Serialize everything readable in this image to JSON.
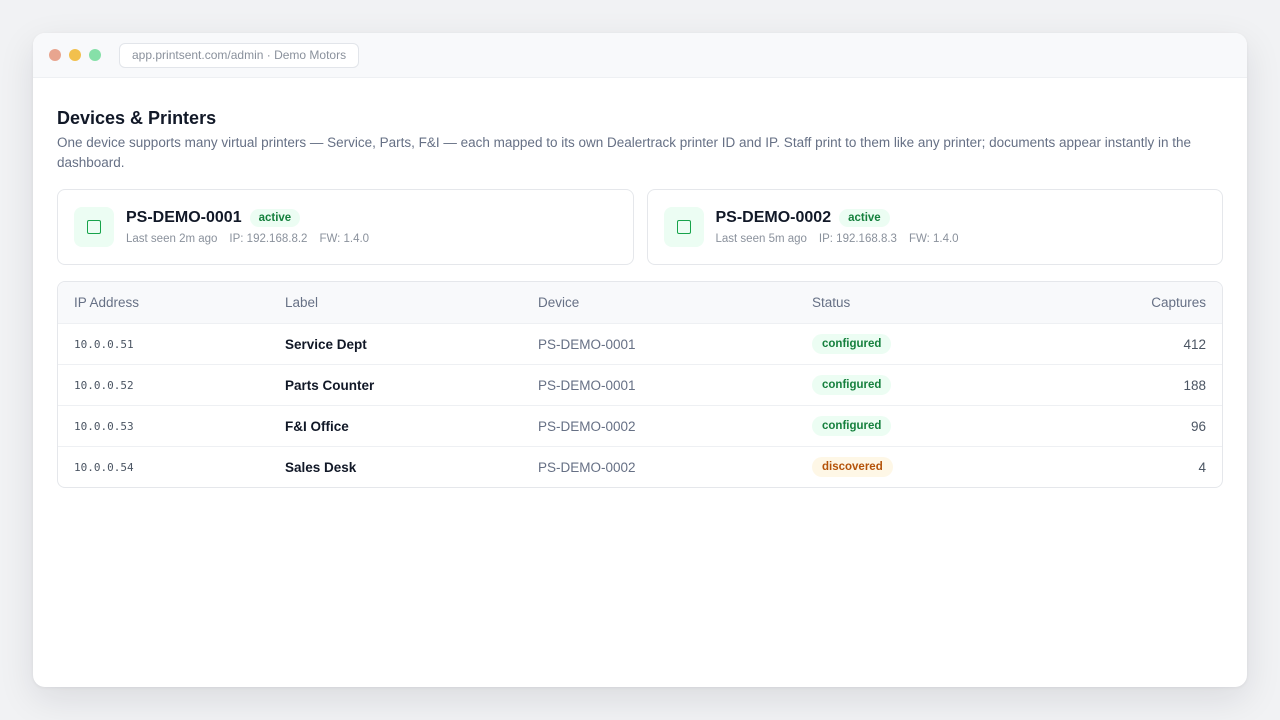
{
  "browser": {
    "url": "app.printsent.com/admin · Demo Motors"
  },
  "page": {
    "title": "Devices & Printers",
    "description": "One device supports many virtual printers — Service, Parts, F&I — each mapped to its own Dealertrack printer ID and IP. Staff print to them like any printer; documents appear instantly in the dashboard."
  },
  "devices": [
    {
      "name": "PS-DEMO-0001",
      "status": "active",
      "last_seen": "Last seen 2m ago",
      "ip": "IP: 192.168.8.2",
      "fw": "FW: 1.4.0"
    },
    {
      "name": "PS-DEMO-0002",
      "status": "active",
      "last_seen": "Last seen 5m ago",
      "ip": "IP: 192.168.8.3",
      "fw": "FW: 1.4.0"
    }
  ],
  "table": {
    "headers": {
      "ip": "IP Address",
      "label": "Label",
      "device": "Device",
      "status": "Status",
      "captures": "Captures"
    },
    "rows": [
      {
        "ip": "10.0.0.51",
        "label": "Service Dept",
        "device": "PS-DEMO-0001",
        "status": "configured",
        "captures": "412"
      },
      {
        "ip": "10.0.0.52",
        "label": "Parts Counter",
        "device": "PS-DEMO-0001",
        "status": "configured",
        "captures": "188"
      },
      {
        "ip": "10.0.0.53",
        "label": "F&I Office",
        "device": "PS-DEMO-0002",
        "status": "configured",
        "captures": "96"
      },
      {
        "ip": "10.0.0.54",
        "label": "Sales Desk",
        "device": "PS-DEMO-0002",
        "status": "discovered",
        "captures": "4"
      }
    ]
  },
  "colors": {
    "active_green": "#15803d",
    "configured_bg": "#ecfdf3",
    "discovered_text": "#b45309",
    "discovered_bg": "#fef7e6"
  }
}
